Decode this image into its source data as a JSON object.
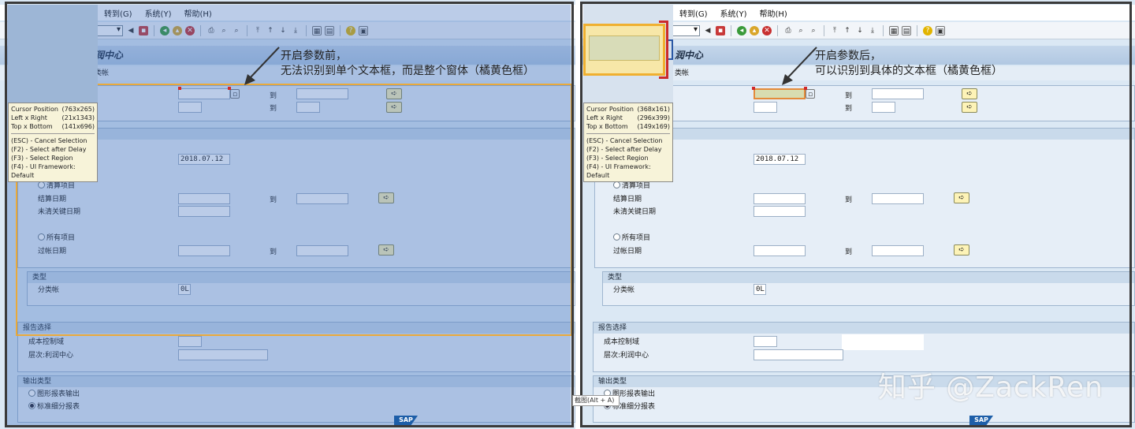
{
  "menu": [
    "转到(G)",
    "系统(Y)",
    "帮助(H)"
  ],
  "screen": {
    "title_fragment": "润中心",
    "subbar_fragment": "类帐"
  },
  "fields": {
    "to_label": "到",
    "date_value": "2018.07.12",
    "open_items": "清算项目",
    "clearing_date": "结算日期",
    "key_date": "未清关键日期",
    "all_items": "所有项目",
    "posting_date": "过帐日期",
    "type_section": "类型",
    "ledger_label": "分类帐",
    "ledger_value": "0L",
    "report_section": "报告选择",
    "controlling_area": "成本控制域",
    "hierarchy_label": "层次:利润中心",
    "output_section": "输出类型",
    "graphic_output": "图形报表输出",
    "detail_report": "标准细分报表"
  },
  "tooltip_left": {
    "rows": [
      {
        "k": "Cursor Position",
        "v": "(763x265)"
      },
      {
        "k": "Left x Right",
        "v": "(21x1343)"
      },
      {
        "k": "Top x Bottom",
        "v": "(141x696)"
      }
    ],
    "keys": [
      "(ESC) - Cancel Selection",
      "(F2)   - Select after Delay",
      "(F3)   - Select Region",
      "(F4)   - UI Framework: Default"
    ]
  },
  "tooltip_right": {
    "rows": [
      {
        "k": "Cursor Position",
        "v": "(368x161)"
      },
      {
        "k": "Left x Right",
        "v": "(296x399)"
      },
      {
        "k": "Top x Bottom",
        "v": "(149x169)"
      }
    ],
    "keys": [
      "(ESC) - Cancel Selection",
      "(F2)   - Select after Delay",
      "(F3)   - Select Region",
      "(F4)   - UI Framework: Default"
    ]
  },
  "annotations": {
    "left_line1": "开启参数前，",
    "left_line2": "无法识别到单个文本框，而是整个窗体（橘黄色框）",
    "right_line1": "开启参数后，",
    "right_line2": "可以识别到具体的文本框（橘黄色框）"
  },
  "watermark": "知乎 @ZackRen",
  "hint": "截图(Alt + A)",
  "sap_logo": "SAP",
  "colors": {
    "highlight": "#e9a93a",
    "overlay": "#3c6ebe",
    "panel_bg": "#dbe8f4"
  }
}
